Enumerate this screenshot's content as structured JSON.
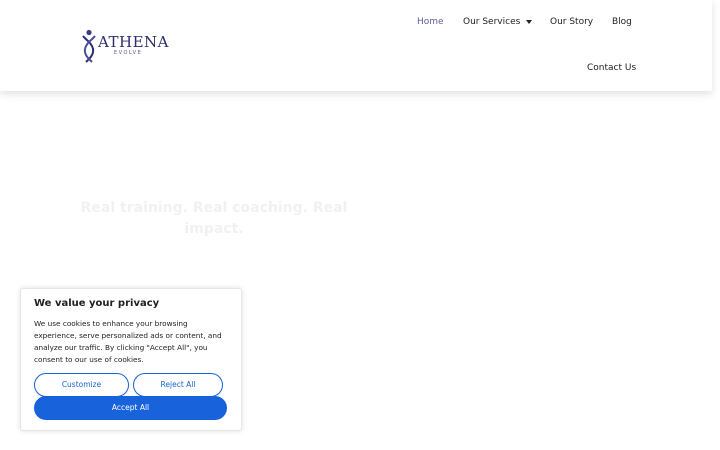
{
  "header": {
    "logo": {
      "word": "ATHENA",
      "sub": "EVOLVE",
      "icon": "figure-logo-icon"
    },
    "nav": {
      "home": "Home",
      "services": "Our Services",
      "story": "Our Story",
      "blog": "Blog",
      "contact": "Contact Us"
    }
  },
  "hero": {
    "title": "Real training. Real coaching. Real impact."
  },
  "cookie_banner": {
    "title": "We value your privacy",
    "text": "We use cookies to enhance your browsing experience, serve personalized ads or content, and analyze our traffic. By clicking \"Accept All\", you consent to our use of cookies.",
    "customize": "Customize",
    "reject": "Reject All",
    "accept": "Accept All"
  },
  "colors": {
    "brand": "#2b2d6e",
    "nav_active": "#5b5f97",
    "accent_button": "#1863dc",
    "hero_text": "#f1f1f3"
  }
}
